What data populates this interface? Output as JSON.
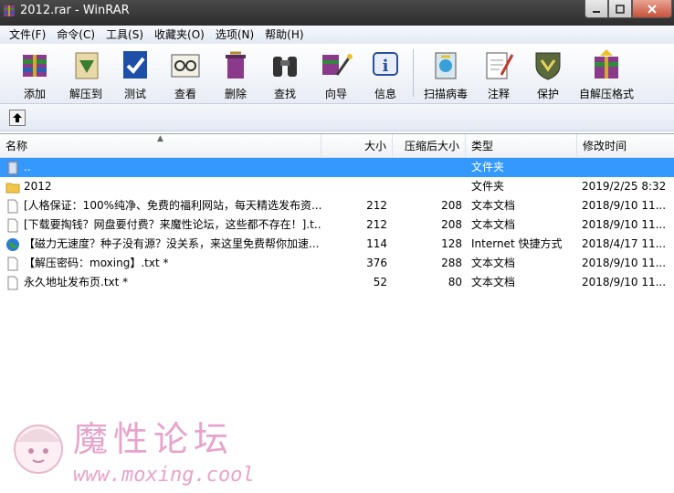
{
  "window": {
    "title": "2012.rar - WinRAR"
  },
  "menu": [
    "文件(F)",
    "命令(C)",
    "工具(S)",
    "收藏夹(O)",
    "选项(N)",
    "帮助(H)"
  ],
  "toolbar": [
    {
      "label": "添加",
      "icon": "add-archive-icon"
    },
    {
      "label": "解压到",
      "icon": "extract-to-icon"
    },
    {
      "label": "测试",
      "icon": "test-icon"
    },
    {
      "label": "查看",
      "icon": "view-icon"
    },
    {
      "label": "删除",
      "icon": "delete-icon"
    },
    {
      "label": "查找",
      "icon": "find-binoculars-icon"
    },
    {
      "label": "向导",
      "icon": "wizard-icon"
    },
    {
      "label": "信息",
      "icon": "info-icon"
    },
    {
      "label": "扫描病毒",
      "icon": "virus-scan-icon"
    },
    {
      "label": "注释",
      "icon": "comment-icon"
    },
    {
      "label": "保护",
      "icon": "protect-shield-icon"
    },
    {
      "label": "自解压格式",
      "icon": "sfx-icon"
    }
  ],
  "columns": {
    "name": "名称",
    "size": "大小",
    "packed": "压缩后大小",
    "type": "类型",
    "modified": "修改时间"
  },
  "files": [
    {
      "name": "..",
      "size": "",
      "packed": "",
      "type": "文件夹",
      "modified": "",
      "icon": "parent-folder-icon",
      "selected": true
    },
    {
      "name": "2012",
      "size": "",
      "packed": "",
      "type": "文件夹",
      "modified": "2019/2/25 8:32",
      "icon": "folder-icon"
    },
    {
      "name": "[人格保证：100%纯净、免费的福利网站，每天精选发布资...",
      "size": "212",
      "packed": "208",
      "type": "文本文档",
      "modified": "2018/9/10 11...",
      "icon": "text-file-icon"
    },
    {
      "name": "[下载要掏钱？网盘要付费？来魔性论坛，这些都不存在！].t...",
      "size": "212",
      "packed": "208",
      "type": "文本文档",
      "modified": "2018/9/10 11...",
      "icon": "text-file-icon"
    },
    {
      "name": "【磁力无速度？种子没有源？没关系，来这里免费帮你加速...",
      "size": "114",
      "packed": "128",
      "type": "Internet 快捷方式",
      "modified": "2018/4/17 11...",
      "icon": "internet-shortcut-icon"
    },
    {
      "name": "【解压密码：moxing】.txt *",
      "size": "376",
      "packed": "288",
      "type": "文本文档",
      "modified": "2018/9/10 11...",
      "icon": "text-file-icon"
    },
    {
      "name": "永久地址发布页.txt *",
      "size": "52",
      "packed": "80",
      "type": "文本文档",
      "modified": "2018/9/10 11...",
      "icon": "text-file-icon"
    }
  ],
  "watermark": {
    "title": "魔性论坛",
    "url": "www.moxing.cool"
  }
}
